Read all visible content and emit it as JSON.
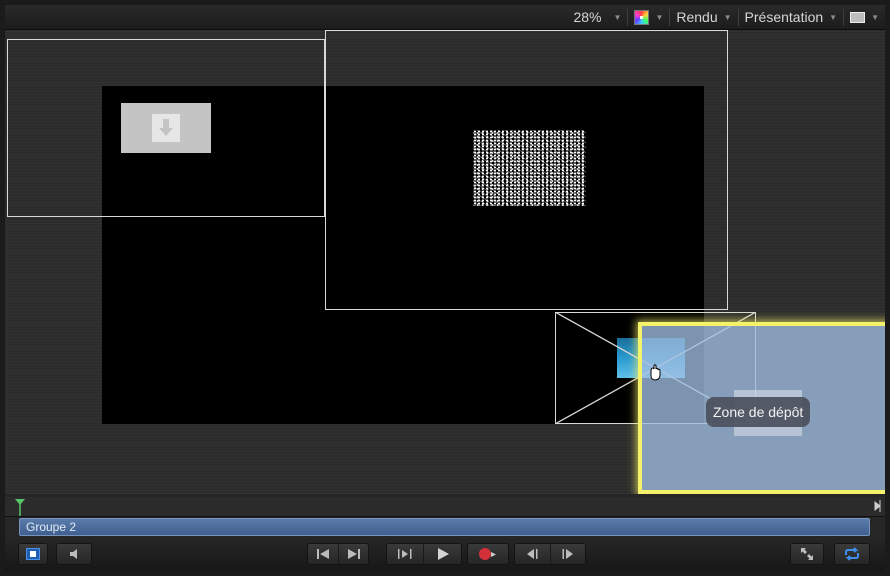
{
  "toolbar": {
    "zoom": "28%",
    "render_label": "Rendu",
    "view_label": "Présentation"
  },
  "canvas": {
    "tooltip": "Zone de dépôt",
    "drop_zone_color": "#f3f26a"
  },
  "timeline": {
    "group_label": "Groupe 2",
    "group_color": "#4a6b9c"
  },
  "transport": {
    "buttons": [
      "toggle-inspector-icon",
      "audio-icon",
      "go-to-start-icon",
      "go-to-end-icon",
      "play-range-icon",
      "play-icon",
      "record-icon",
      "previous-frame-icon",
      "next-frame-icon",
      "fullscreen-icon",
      "loop-icon"
    ]
  }
}
